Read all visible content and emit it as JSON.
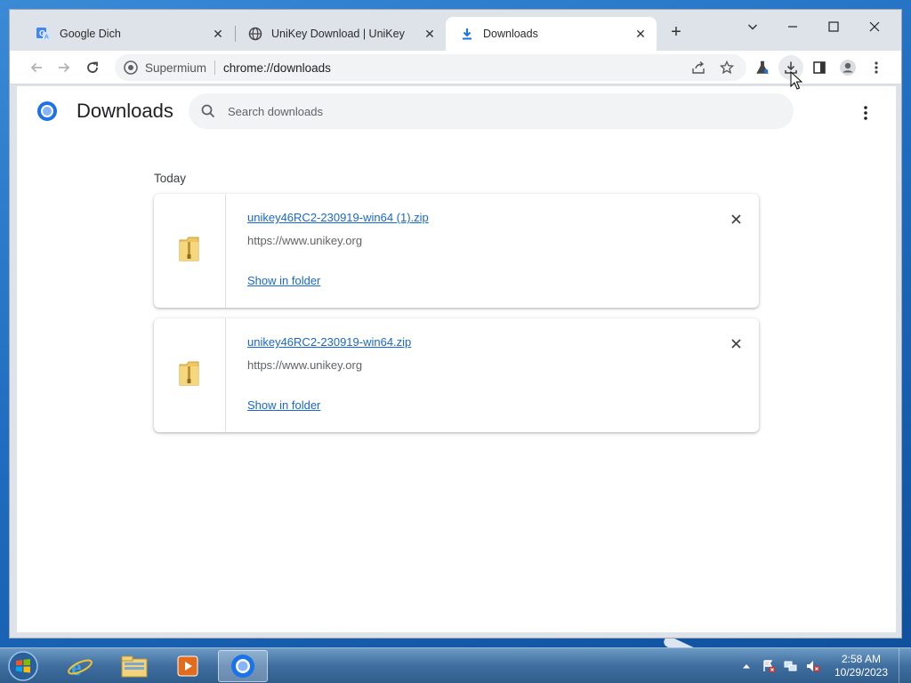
{
  "browser": {
    "tabs": [
      {
        "title": "Google Dich",
        "icon": "google-translate-icon",
        "active": false
      },
      {
        "title": "UniKey Download | UniKey",
        "icon": "globe-icon",
        "active": false
      },
      {
        "title": "Downloads",
        "icon": "download-icon",
        "active": true
      }
    ],
    "new_tab_label": "+",
    "omnibox": {
      "site_name": "Supermium",
      "url": "chrome://downloads"
    }
  },
  "page": {
    "title": "Downloads",
    "search_placeholder": "Search downloads",
    "date_heading": "Today",
    "downloads": [
      {
        "file_name": "unikey46RC2-230919-win64 (1).zip",
        "source_url": "https://www.unikey.org",
        "action_label": "Show in folder"
      },
      {
        "file_name": "unikey46RC2-230919-win64.zip",
        "source_url": "https://www.unikey.org",
        "action_label": "Show in folder"
      }
    ]
  },
  "taskbar": {
    "apps": [
      "internet-explorer-icon",
      "file-explorer-icon",
      "media-player-icon",
      "supermium-icon"
    ],
    "clock": {
      "time": "2:58 AM",
      "date": "10/29/2023"
    }
  },
  "colors": {
    "link": "#1967d2",
    "tab_bar": "#dee3ea",
    "taskbar": "#3f6e9f"
  }
}
